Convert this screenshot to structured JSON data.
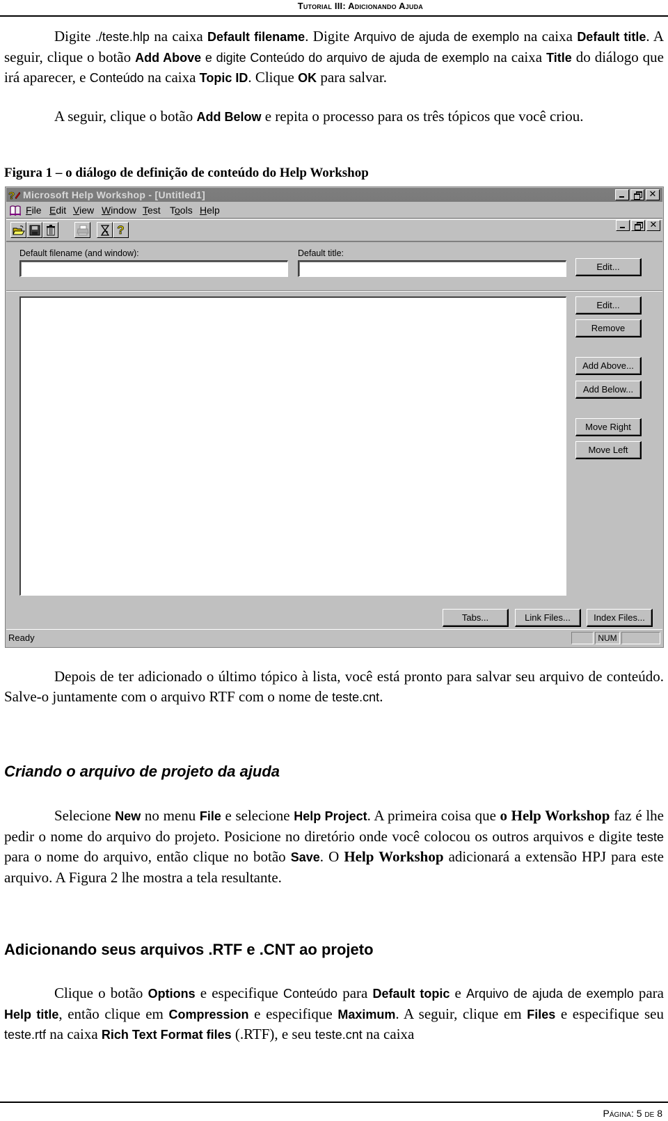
{
  "header": {
    "running_title": "Tutorial III: Adicionando Ajuda"
  },
  "paragraph1": {
    "t1": "Digite ",
    "t2": "./teste.hlp",
    "t3": " na caixa ",
    "b1": "Default filename",
    "t4": ". Digite ",
    "t5": "Arquivo de ajuda de exemplo",
    "t6": " na caixa ",
    "b2": "Default title",
    "t7": ". A seguir, clique o botão ",
    "b3": "Add Above",
    "t8": " e digite ",
    "t9": "Conteúdo do arquivo de ajuda de exemplo",
    "t10": " na caixa ",
    "b4": "Title",
    "t11": " do diálogo que irá aparecer, e ",
    "t12": "Conteúdo",
    "t13": " na caixa ",
    "b5": "Topic ID",
    "t14": ". Clique ",
    "b6": "OK",
    "t15": " para salvar."
  },
  "paragraph2": {
    "t1": "A seguir, clique o botão ",
    "b1": "Add Below",
    "t2": " e repita o processo para os três tópicos que você criou."
  },
  "figure": {
    "caption": "Figura 1 – o diálogo de definição de conteúdo do Help Workshop",
    "window": {
      "title": "Microsoft Help Workshop - [Untitled1]",
      "menu": [
        {
          "label": "File",
          "accel": "F",
          "rest": "ile"
        },
        {
          "label": "Edit",
          "accel": "E",
          "rest": "dit"
        },
        {
          "label": "View",
          "accel": "V",
          "rest": "iew"
        },
        {
          "label": "Window",
          "accel": "W",
          "rest": "indow"
        },
        {
          "label": "Test",
          "accel": "T",
          "rest": "est"
        },
        {
          "label": "Tools",
          "pre": "T",
          "accel": "o",
          "rest": "ols"
        },
        {
          "label": "Help",
          "accel": "H",
          "rest": "elp"
        }
      ],
      "toolbar": [
        "open-folder",
        "save",
        "delete",
        "print",
        "compile",
        "help"
      ],
      "default_filename_label": "Default filename (and window):",
      "default_filename_value": "",
      "default_title_label": "Default title:",
      "default_title_value": "",
      "buttons": {
        "edit_top": "Edit...",
        "edit": "Edit...",
        "remove": "Remove",
        "add_above": "Add Above...",
        "add_below": "Add Below...",
        "move_right": "Move Right",
        "move_left": "Move Left",
        "tabs": "Tabs...",
        "link_files": "Link Files...",
        "index_files": "Index Files..."
      },
      "status": {
        "text": "Ready",
        "num": "NUM"
      }
    }
  },
  "paragraph3": {
    "t1": "Depois de ter adicionado o último tópico à lista, você está pronto para salvar seu arquivo de conteúdo. Salve-o juntamente com o arquivo RTF com o nome de ",
    "t2": "teste.cnt",
    "t3": "."
  },
  "section1": {
    "heading": "Criando o arquivo de projeto da ajuda"
  },
  "paragraph4": {
    "t1": "Selecione ",
    "b1": "New",
    "t2": " no menu ",
    "b2": "File",
    "t3": " e selecione ",
    "b3": "Help Project",
    "t4": ". A primeira coisa que ",
    "b4": "o Help Workshop",
    "t5": " faz é lhe pedir o nome do arquivo do projeto. Posicione no diretório onde você colocou os outros arquivos e digite ",
    "t6": "teste",
    "t7": " para o nome do arquivo, então clique no botão ",
    "b5": "Save",
    "t8": ". O ",
    "b6": "Help Workshop",
    "t9": " adicionará a extensão HPJ para este arquivo. A Figura 2 lhe mostra a tela resultante."
  },
  "section2": {
    "heading": "Adicionando seus arquivos .RTF e .CNT ao projeto"
  },
  "paragraph5": {
    "t1": "Clique o botão ",
    "b1": "Options",
    "t2": " e especifique ",
    "t3": "Conteúdo",
    "t4": " para ",
    "b2": "Default topic",
    "t5": " e ",
    "t6": "Arquivo de ajuda de exemplo",
    "t7": " para ",
    "b3": "Help title",
    "t8": ", então clique em ",
    "b4": "Compression",
    "t9": " e especifique ",
    "b5": "Maximum",
    "t10": ". A seguir, clique em ",
    "b6": "Files",
    "t11": " e especifique seu ",
    "t12": "teste.rtf",
    "t13": " na caixa ",
    "b7": "Rich Text Format files",
    "t14": " (.RTF), e seu ",
    "t15": "teste.cnt",
    "t16": " na caixa"
  },
  "footer": {
    "page_label": "Página: 5 de 8"
  }
}
